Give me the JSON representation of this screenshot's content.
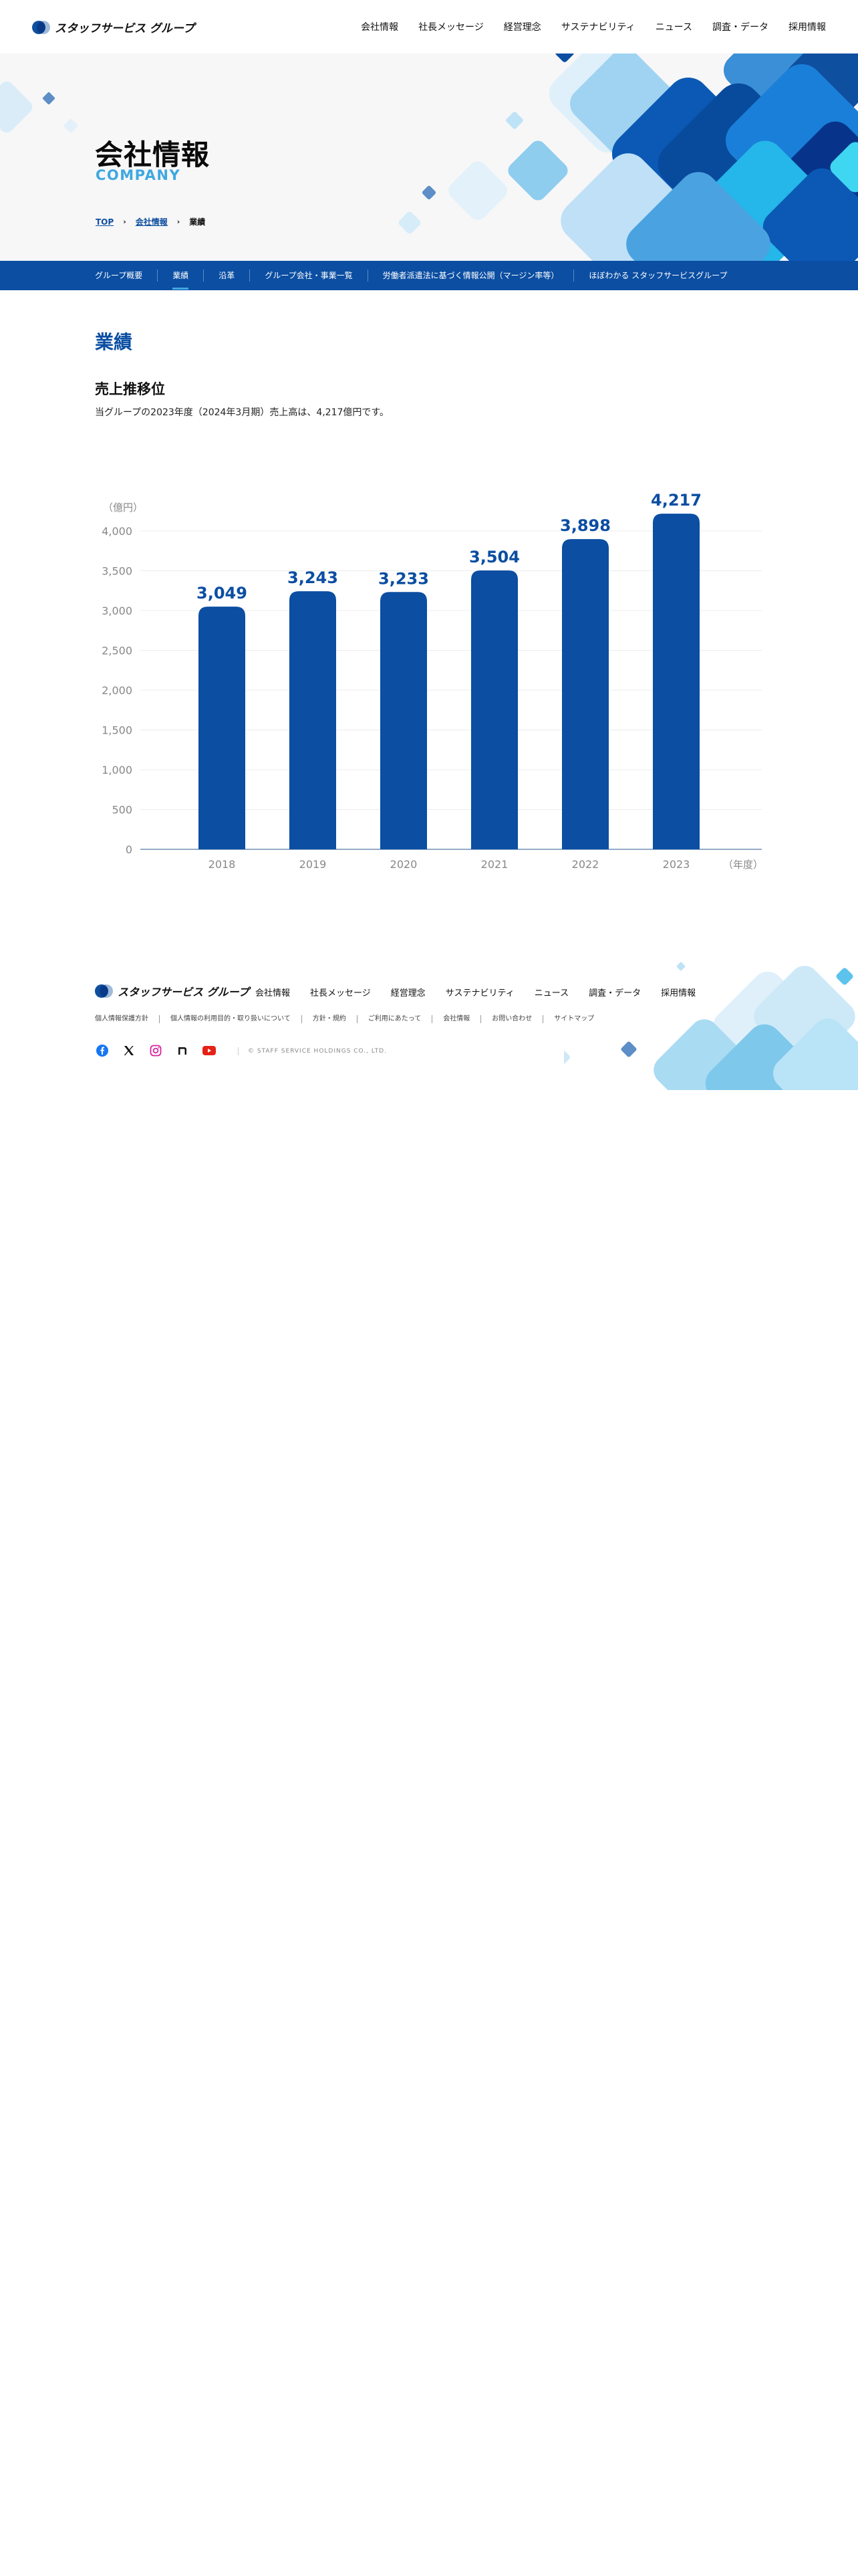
{
  "header": {
    "logo_text": "スタッフサービス グループ",
    "nav": [
      "会社情報",
      "社長メッセージ",
      "経営理念",
      "サステナビリティ",
      "ニュース",
      "調査・データ",
      "採用情報"
    ]
  },
  "hero": {
    "title": "会社情報",
    "subtitle": "COMPANY",
    "breadcrumb": {
      "top": "TOP",
      "parent": "会社情報",
      "current": "業績"
    }
  },
  "subnav": {
    "items": [
      "グループ概要",
      "業績",
      "沿革",
      "グループ会社・事業一覧",
      "労働者派遣法に基づく情報公開（マージン率等）",
      "ほぼわかる スタッフサービスグループ"
    ],
    "active_index": 1
  },
  "main": {
    "section_title": "業績",
    "sub_heading": "売上推移位",
    "lead": "当グループの2023年度（2024年3月期）売上高は、4,217億円です。"
  },
  "chart_data": {
    "type": "bar",
    "categories": [
      "2018",
      "2019",
      "2020",
      "2021",
      "2022",
      "2023"
    ],
    "values": [
      3049,
      3243,
      3233,
      3504,
      3898,
      4217
    ],
    "value_labels": [
      "3,049",
      "3,243",
      "3,233",
      "3,504",
      "3,898",
      "4,217"
    ],
    "y_unit_label": "（億円）",
    "x_unit_label": "（年度）",
    "yticks": [
      0,
      500,
      1000,
      1500,
      2000,
      2500,
      3000,
      3500,
      4000
    ],
    "ytick_labels": [
      "0",
      "500",
      "1,000",
      "1,500",
      "2,000",
      "2,500",
      "3,000",
      "3,500",
      "4,000"
    ],
    "ylim": [
      0,
      4000
    ],
    "grid": true,
    "bar_color": "#0b4ea2",
    "label_color": "#0b4ea2"
  },
  "footer": {
    "logo_text": "スタッフサービス グループ",
    "nav": [
      "会社情報",
      "社長メッセージ",
      "経営理念",
      "サステナビリティ",
      "ニュース",
      "調査・データ",
      "採用情報"
    ],
    "links": [
      "個人情報保護方針",
      "個人情報の利用目的・取り扱いについて",
      "方針・規約",
      "ご利用にあたって",
      "会社情報",
      "お問い合わせ",
      "サイトマップ"
    ],
    "social": [
      "facebook-icon",
      "x-icon",
      "instagram-icon",
      "note-icon",
      "youtube-icon"
    ],
    "copyright": "© STAFF SERVICE HOLDINGS CO., LTD."
  },
  "colors": {
    "brand_blue": "#0b4ea2",
    "accent_cyan": "#3ea8e0"
  }
}
